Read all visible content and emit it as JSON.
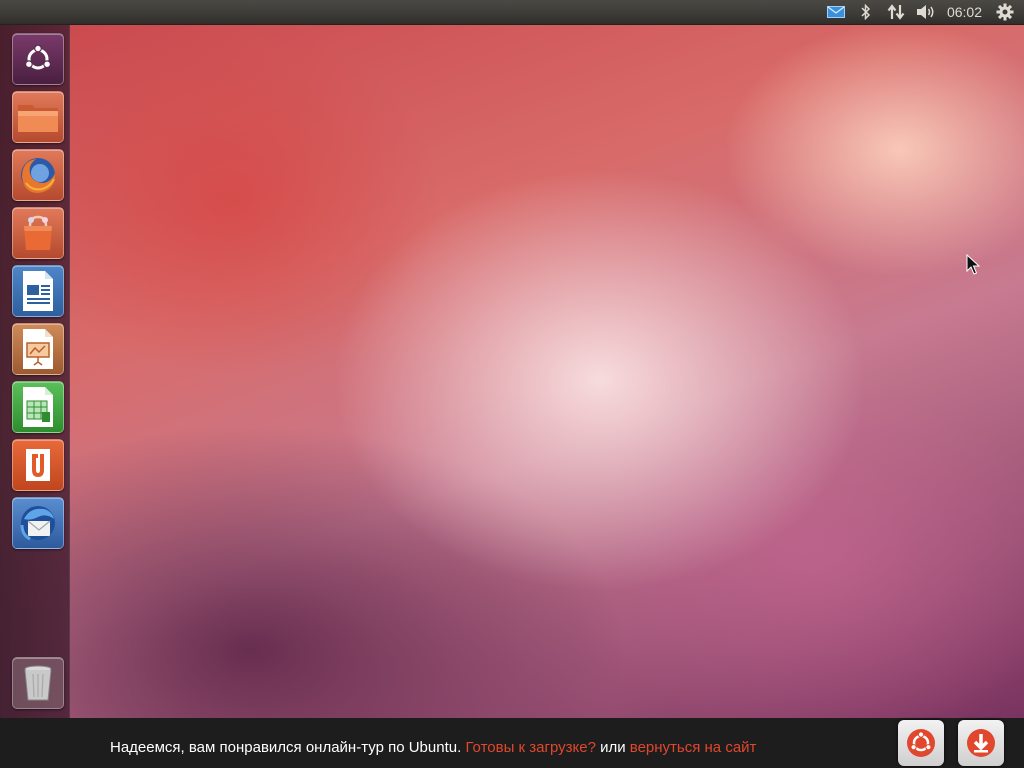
{
  "top_panel": {
    "indicators": [
      "mail-icon",
      "bluetooth-icon",
      "network-icon",
      "volume-icon"
    ],
    "clock": "06:02",
    "session_icon": "gear-icon"
  },
  "launcher": {
    "items": [
      {
        "name": "dash-home",
        "icon": "ubuntu-logo-icon"
      },
      {
        "name": "home-folder",
        "icon": "folder-icon"
      },
      {
        "name": "firefox",
        "icon": "firefox-icon"
      },
      {
        "name": "software-center",
        "icon": "shopping-bag-icon"
      },
      {
        "name": "libreoffice-writer",
        "icon": "writer-document-icon"
      },
      {
        "name": "libreoffice-impress",
        "icon": "impress-presentation-icon"
      },
      {
        "name": "libreoffice-calc",
        "icon": "calc-spreadsheet-icon"
      },
      {
        "name": "ubuntu-one",
        "icon": "ubuntu-one-icon"
      },
      {
        "name": "thunderbird",
        "icon": "thunderbird-icon"
      }
    ],
    "trash_icon": "trash-icon"
  },
  "tour_bar": {
    "message": "Надеемся, вам понравился онлайн-тур по Ubuntu. ",
    "download_link": "Готовы к загрузке?",
    "or_text": " или ",
    "site_link": "вернуться на сайт",
    "buttons": [
      "ubuntu-site-icon",
      "download-icon"
    ]
  },
  "colors": {
    "accent": "#e0472c",
    "panel": "#3c3b37",
    "bottom_bar": "#1d1d1d"
  }
}
